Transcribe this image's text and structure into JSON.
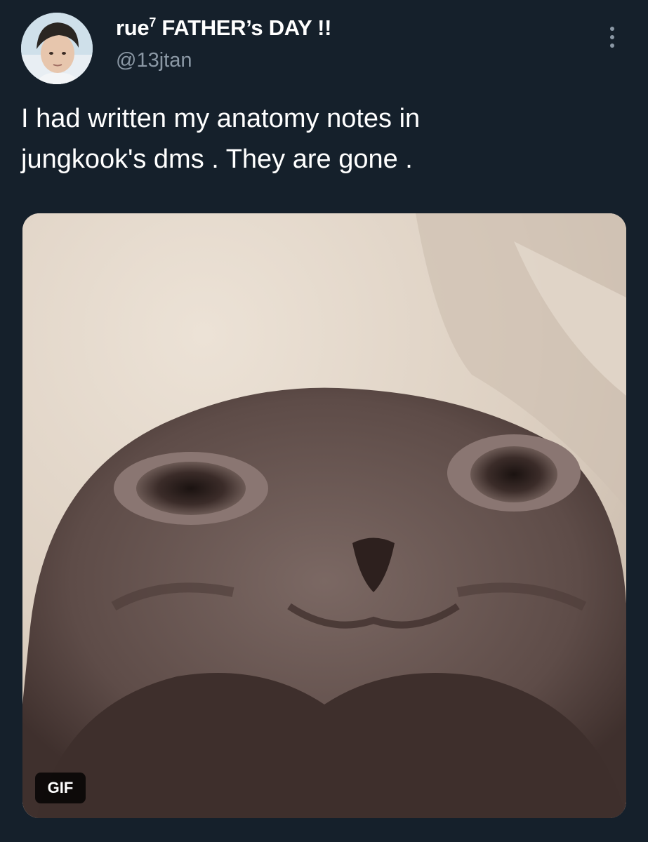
{
  "author": {
    "display_name": "rue",
    "display_name_superscript": "7",
    "display_name_suffix": " FATHER’s DAY !!",
    "handle": "@13jtan"
  },
  "tweet": {
    "text_line1": "I had written my anatomy notes in",
    "text_line2": "jungkook's dms . They are gone ."
  },
  "media": {
    "badge": "GIF"
  },
  "icons": {
    "more": "more-options-icon",
    "avatar": "avatar"
  },
  "colors": {
    "background": "#15202b",
    "secondary_text": "#8b98a5",
    "primary_text": "#ffffff"
  }
}
